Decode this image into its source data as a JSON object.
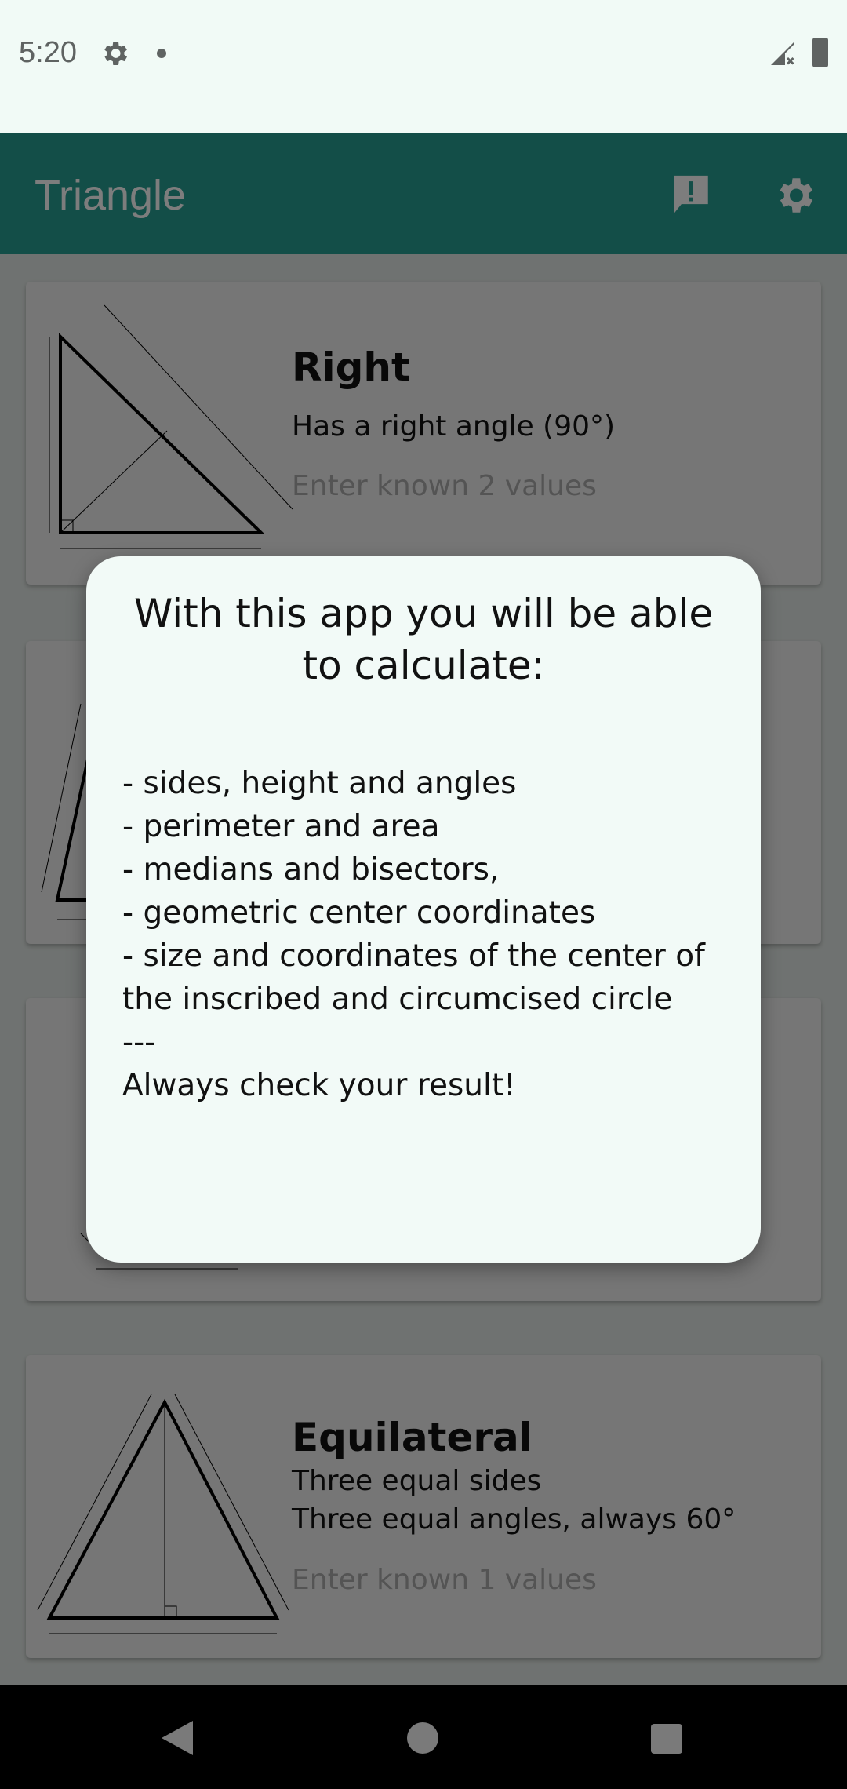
{
  "status_bar": {
    "time": "5:20",
    "icons": [
      "gear-icon",
      "notification-dot-icon",
      "signal-off-icon",
      "battery-icon"
    ]
  },
  "app_bar": {
    "title": "Triangle",
    "actions": [
      "feedback-icon",
      "settings-icon"
    ],
    "color": "#269c90"
  },
  "cards": [
    {
      "title": "Right",
      "subtitle": "Has a right angle (90°)",
      "hint": "Enter known 2 values"
    },
    {},
    {},
    {
      "title": "Equilateral",
      "subtitle": "Three equal sides",
      "subtitle2": "Three equal angles, always 60°",
      "hint": "Enter known 1 values"
    }
  ],
  "dialog": {
    "title": "With this app you will be able to calculate:",
    "body": "- sides, height and angles\n- perimeter and area\n- medians and bisectors,\n- geometric center coordinates\n- size and coordinates of the center of the inscribed and circumcised circle\n---\nAlways check your result!"
  },
  "nav_bar": {
    "buttons": [
      "back-icon",
      "home-icon",
      "recents-icon"
    ]
  }
}
